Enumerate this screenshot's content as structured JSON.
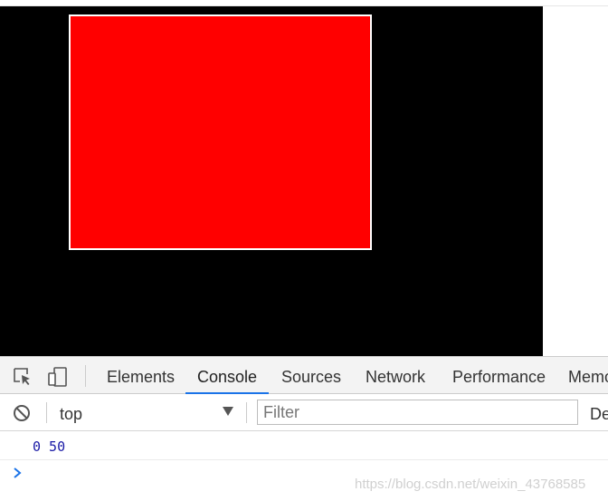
{
  "viewport": {
    "canvas_color": "#000000",
    "box_color": "#ff0000"
  },
  "devtools": {
    "tabs": [
      {
        "label": "Elements"
      },
      {
        "label": "Console"
      },
      {
        "label": "Sources"
      },
      {
        "label": "Network"
      },
      {
        "label": "Performance"
      },
      {
        "label": "Memo"
      }
    ],
    "active_tab": "Console",
    "accent_color": "#1a73e8",
    "icons": [
      "inspect-element-icon",
      "device-toggle-icon",
      "clear-console-icon",
      "dropdown-arrow-icon",
      "prompt-chevron-icon"
    ]
  },
  "console_toolbar": {
    "context": "top",
    "filter_placeholder": "Filter",
    "levels_label": "De"
  },
  "console": {
    "log_line": "0 50",
    "watermark": "https://blog.csdn.net/weixin_43768585"
  }
}
